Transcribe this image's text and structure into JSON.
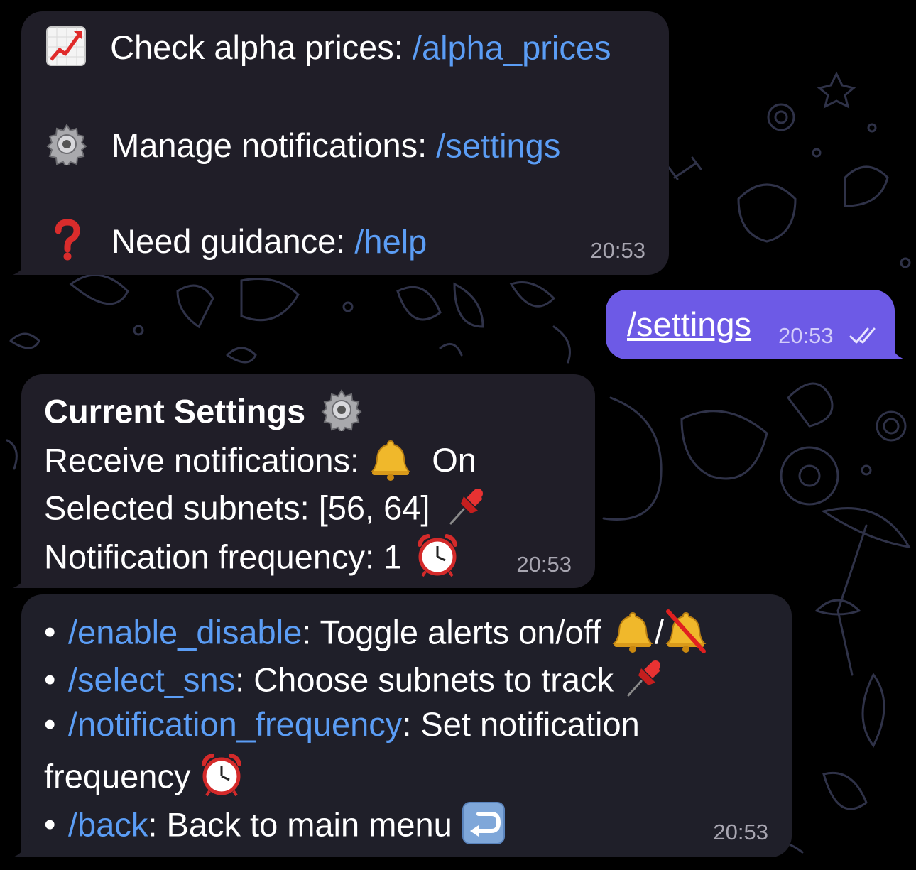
{
  "messages": {
    "m1": {
      "l1_label": "Check alpha prices: ",
      "l1_link": "/alpha_prices",
      "l2_label": "Manage notifications: ",
      "l2_link": "/settings",
      "l3_label": "Need guidance: ",
      "l3_link": "/help",
      "time": "20:53",
      "icons": [
        "chart-increasing-icon",
        "gear-icon",
        "question-mark-icon"
      ]
    },
    "m2": {
      "text": "/settings",
      "time": "20:53",
      "status": "read-double-check"
    },
    "m3": {
      "title": "Current Settings",
      "notif_label": "Receive notifications: ",
      "notif_value": "On",
      "subnets_label": "Selected subnets: [56, 64]",
      "freq_label": "Notification frequency: 1",
      "time": "20:53",
      "icons": [
        "gear-icon",
        "bell-icon",
        "pushpin-icon",
        "alarm-clock-icon"
      ]
    },
    "m4": {
      "c1": "/enable_disable",
      "d1": ": Toggle alerts on/off ",
      "sep": "/",
      "c2": "/select_sns",
      "d2": ": Choose subnets to track ",
      "c3": "/notification_frequency",
      "d3": ": Set notification",
      "d3b": "frequency ",
      "c4": "/back",
      "d4": ": Back to main menu ",
      "time": "20:53",
      "icons": [
        "bell-icon",
        "bell-slash-icon",
        "pushpin-icon",
        "alarm-clock-icon",
        "return-arrow-icon"
      ]
    }
  },
  "colors": {
    "incoming_bubble": "#201e28",
    "outgoing_bubble": "#6d5ae6",
    "link": "#5b9df5",
    "background": "#000000"
  }
}
